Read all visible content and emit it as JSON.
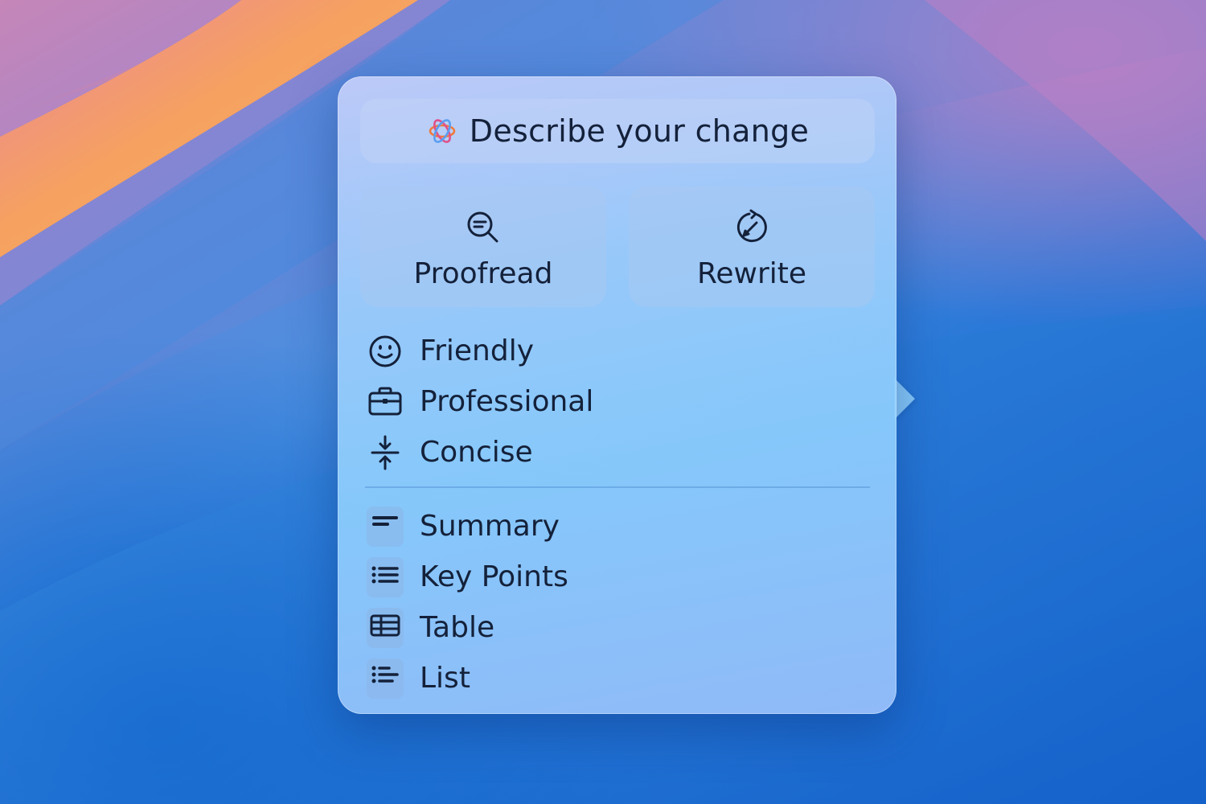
{
  "writing_tools": {
    "describe_placeholder": "Describe your change",
    "proofread_label": "Proofread",
    "rewrite_label": "Rewrite",
    "tones": [
      {
        "label": "Friendly",
        "icon": "smiley-icon"
      },
      {
        "label": "Professional",
        "icon": "briefcase-icon"
      },
      {
        "label": "Concise",
        "icon": "compress-arrows-icon"
      }
    ],
    "formats": [
      {
        "label": "Summary",
        "icon": "summary-lines-icon"
      },
      {
        "label": "Key Points",
        "icon": "bullet-list-icon"
      },
      {
        "label": "Table",
        "icon": "table-icon"
      },
      {
        "label": "List",
        "icon": "list-icon"
      }
    ]
  },
  "colors": {
    "text": "#14213a",
    "icon": "#14213a",
    "wallpaper_orange": "#f4a15c",
    "wallpaper_blue": "#1a64cc"
  }
}
